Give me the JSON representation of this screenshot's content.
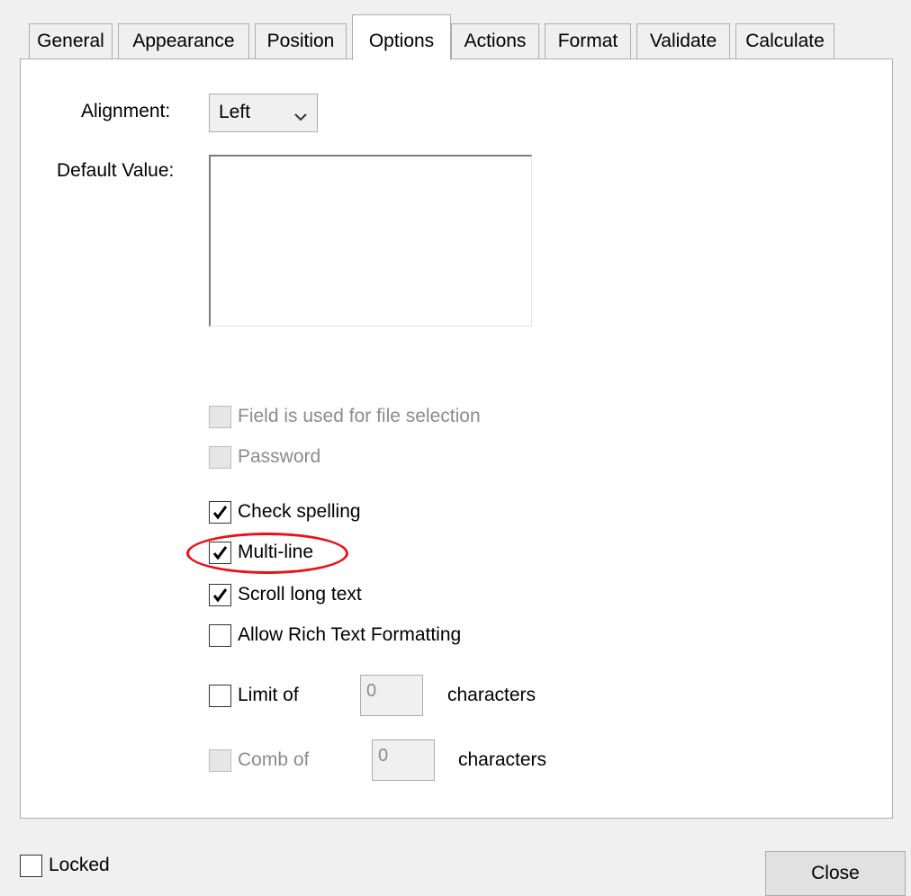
{
  "tabs": [
    {
      "label": "General"
    },
    {
      "label": "Appearance"
    },
    {
      "label": "Position"
    },
    {
      "label": "Options",
      "active": true
    },
    {
      "label": "Actions"
    },
    {
      "label": "Format"
    },
    {
      "label": "Validate"
    },
    {
      "label": "Calculate"
    }
  ],
  "options": {
    "alignment_label": "Alignment:",
    "alignment_value": "Left",
    "default_value_label": "Default Value:",
    "default_value": "",
    "file_selection": {
      "label": "Field is used for file selection",
      "checked": false,
      "enabled": false
    },
    "password": {
      "label": "Password",
      "checked": false,
      "enabled": false
    },
    "check_spelling": {
      "label": "Check spelling",
      "checked": true,
      "enabled": true
    },
    "multi_line": {
      "label": "Multi-line",
      "checked": true,
      "enabled": true,
      "highlighted": true
    },
    "scroll_long_text": {
      "label": "Scroll long text",
      "checked": true,
      "enabled": true
    },
    "rich_text": {
      "label": "Allow Rich Text Formatting",
      "checked": false,
      "enabled": true
    },
    "limit": {
      "label": "Limit of",
      "checked": false,
      "value": "0",
      "suffix": "characters"
    },
    "comb": {
      "label": "Comb of",
      "checked": false,
      "enabled": false,
      "value": "0",
      "suffix": "characters"
    }
  },
  "footer": {
    "locked_label": "Locked",
    "locked_checked": false,
    "close_label": "Close"
  },
  "colors": {
    "highlight": "#e8121a",
    "panel_bg": "#ffffff",
    "window_bg": "#f0f0f0"
  }
}
